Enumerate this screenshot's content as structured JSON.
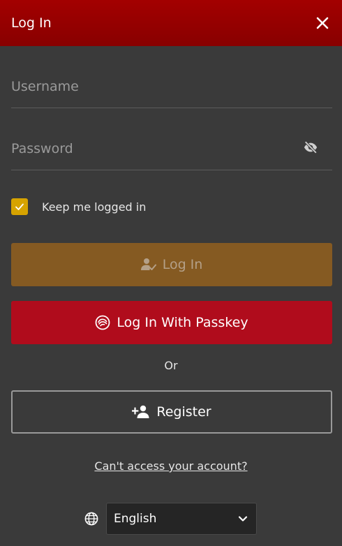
{
  "header": {
    "title": "Log In",
    "close_icon": "close-icon"
  },
  "form": {
    "username_placeholder": "Username",
    "username_value": "",
    "password_placeholder": "Password",
    "password_value": "",
    "password_toggle_icon": "eye-slash-icon",
    "remember_label": "Keep me logged in",
    "remember_checked": true
  },
  "buttons": {
    "login_label": "Log In",
    "login_icon": "user-check-icon",
    "passkey_label": "Log In With Passkey",
    "passkey_icon": "passkey-icon",
    "or_text": "Or",
    "register_label": "Register",
    "register_icon": "user-plus-icon"
  },
  "links": {
    "cant_access": "Can't access your account?"
  },
  "language": {
    "icon": "globe-icon",
    "selected": "English"
  },
  "colors": {
    "header_bg": "#9a0000",
    "panel_bg": "#3a3a3a",
    "login_button": "#855a22",
    "passkey_button": "#b00c1c",
    "checkbox": "#d6a300"
  }
}
